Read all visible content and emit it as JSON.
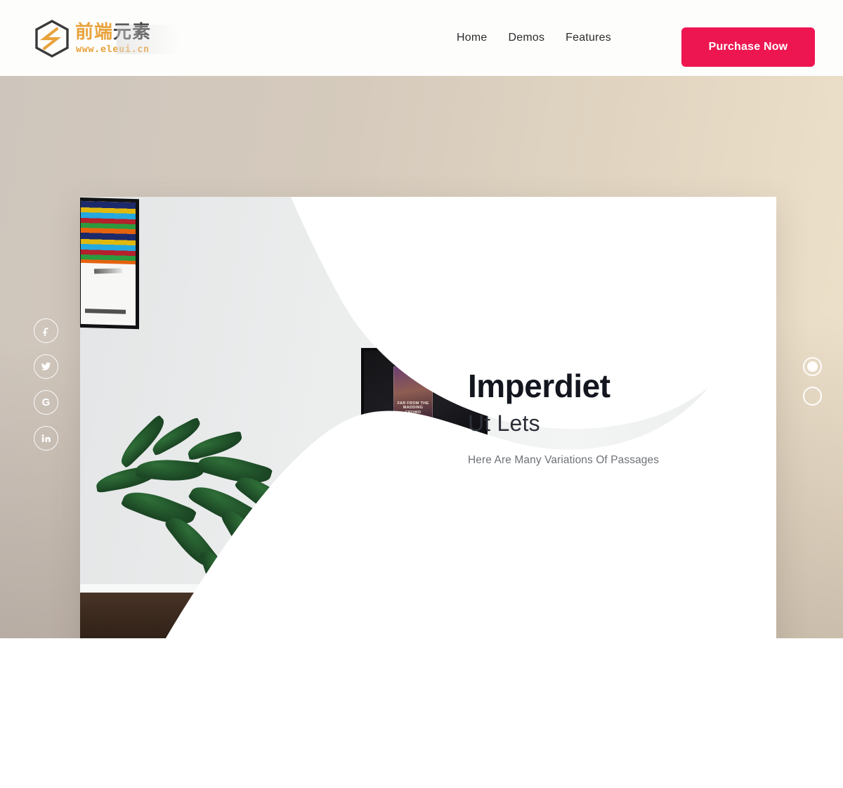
{
  "header": {
    "brand": {
      "name_cn_orange": "前端",
      "name_cn_dark": "元素",
      "url": "www.eleui.cn",
      "logo_icon": "hexagon-logo-icon"
    },
    "nav": [
      {
        "label": "Home",
        "name": "nav-link-home"
      },
      {
        "label": "Demos",
        "name": "nav-link-demos"
      },
      {
        "label": "Features",
        "name": "nav-link-features"
      }
    ],
    "cta": {
      "label": "Purchase Now",
      "color": "#ED1651"
    }
  },
  "hero": {
    "background": {
      "gradient_from": "#cec5bc",
      "gradient_to": "#efe2cb"
    },
    "social": [
      {
        "name": "facebook-icon",
        "glyph": "f"
      },
      {
        "name": "twitter-icon",
        "glyph": "t"
      },
      {
        "name": "google-plus-icon",
        "glyph": "G"
      },
      {
        "name": "linkedin-icon",
        "glyph": "in"
      }
    ],
    "slide": {
      "title": "Imperdiet",
      "subtitle": "Ut Lets",
      "description": "Here Are Many Variations Of Passages",
      "image_alt": "Living room with white media console, TV, plant and speaker",
      "poster_text": "FAR FROM THE MADDING CROWD"
    },
    "slider_dots": [
      {
        "name": "slider-dot-1",
        "active": true
      },
      {
        "name": "slider-dot-2",
        "active": false
      }
    ]
  }
}
